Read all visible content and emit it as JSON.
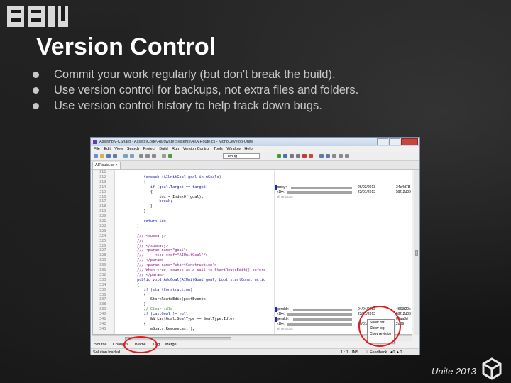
{
  "slide": {
    "title": "Version Control",
    "bullets": [
      "Commit your work regularly (but don't break the build).",
      "Use version control for backups, not extra files and folders.",
      "Use version control history to help track down bugs."
    ],
    "footer": "Unite 2013",
    "logo_text": "BBI"
  },
  "ide": {
    "window_title": "Assembly-CSharp - Assets\\Code\\Hardware\\Systems\\AI\\AIRoute.cs - MonoDevelop-Unity",
    "menu": [
      "File",
      "Edit",
      "View",
      "Search",
      "Project",
      "Build",
      "Run",
      "Version Control",
      "Tools",
      "Window",
      "Help"
    ],
    "config_combo": "Debug",
    "doc_tab": "AIRoute.cs ×",
    "code_lines": [
      {
        "n": "311",
        "t": ""
      },
      {
        "n": "312",
        "t": "            foreach (AIUnitGoal goal in mGoals)",
        "c": "kw"
      },
      {
        "n": "313",
        "t": "            {"
      },
      {
        "n": "314",
        "t": "               if (goal.Target == target)",
        "c": "kw"
      },
      {
        "n": "315",
        "t": "               {"
      },
      {
        "n": "316",
        "t": "                   idx = IndexOf(goal);"
      },
      {
        "n": "317",
        "t": "                   break;",
        "c": "kw"
      },
      {
        "n": "318",
        "t": "               }"
      },
      {
        "n": "319",
        "t": "            }"
      },
      {
        "n": "320",
        "t": ""
      },
      {
        "n": "321",
        "t": "            return idx;",
        "c": "kw"
      },
      {
        "n": "322",
        "t": "         }"
      },
      {
        "n": "323",
        "t": ""
      },
      {
        "n": "324",
        "t": "         /// <summary>",
        "c": "doc"
      },
      {
        "n": "325",
        "t": "         ///",
        "c": "doc"
      },
      {
        "n": "326",
        "t": "         /// </summary>",
        "c": "doc"
      },
      {
        "n": "327",
        "t": "         /// <param name=\"goal\">",
        "c": "doc"
      },
      {
        "n": "328",
        "t": "         ///     <see cref=\"AIUnitGoal\"/>",
        "c": "doc"
      },
      {
        "n": "329",
        "t": "         /// </param>",
        "c": "doc"
      },
      {
        "n": "330",
        "t": "         /// <param name=\"startConstruction\">",
        "c": "doc"
      },
      {
        "n": "331",
        "t": "         /// When true, counts as a call to StartRouteEdit() before",
        "c": "doc"
      },
      {
        "n": "332",
        "t": "         /// </param>",
        "c": "doc"
      },
      {
        "n": "333",
        "t": "         public void AddGoal(AIUnitGoal goal, bool startConstructio",
        "c": "kw"
      },
      {
        "n": "334",
        "t": "         {"
      },
      {
        "n": "335",
        "t": "            if (startConstruction)",
        "c": "kw"
      },
      {
        "n": "336",
        "t": "            {"
      },
      {
        "n": "337",
        "t": "               StartRouteEdit(postEvents);"
      },
      {
        "n": "338",
        "t": "            }"
      },
      {
        "n": "339",
        "t": "            // Clear idle",
        "c": "cm"
      },
      {
        "n": "340",
        "t": "            if (LastGoal != null",
        "c": "kw"
      },
      {
        "n": "341",
        "t": "               && LastGoal.GoalType == GoalType.Idle)"
      },
      {
        "n": "342",
        "t": "            {"
      },
      {
        "n": "343",
        "t": "               mGoals.RemoveLast();"
      }
    ],
    "blame": [
      {
        "line": 3,
        "who": "rocky<",
        "date": "26/03/2013",
        "rev": "34e4d78",
        "mark": true
      },
      {
        "line": 4,
        "who": "v2k<",
        "date": "23/01/2013",
        "rev": "59f12d09"
      },
      {
        "line": 5,
        "msg": "AI refactor"
      },
      {
        "line": 28,
        "who": "gerald<",
        "date": "04/04/2013",
        "rev": "4663f20c",
        "mark": true
      },
      {
        "line": 29,
        "who": "v2k<",
        "date": "23/01/2013",
        "rev": "59f12d09"
      },
      {
        "line": 30,
        "who": "gerald<",
        "date": "",
        "rev": "01aa3d",
        "mark": true
      },
      {
        "line": 31,
        "who": "v2k<",
        "date": "26/01/",
        "rev": "2d09"
      },
      {
        "line": 32,
        "msg": "AI refactor"
      }
    ],
    "context_menu": [
      "Show diff",
      "Show log",
      "Copy revision"
    ],
    "bottom_tabs": [
      "Source",
      "Changes",
      "Blame",
      "Log",
      "Merge"
    ],
    "status": {
      "left": "Solution loaded.",
      "position": "1 : 1",
      "mode": "INS",
      "feedback": "Feedback",
      "errors": "0",
      "warnings": "0"
    }
  }
}
